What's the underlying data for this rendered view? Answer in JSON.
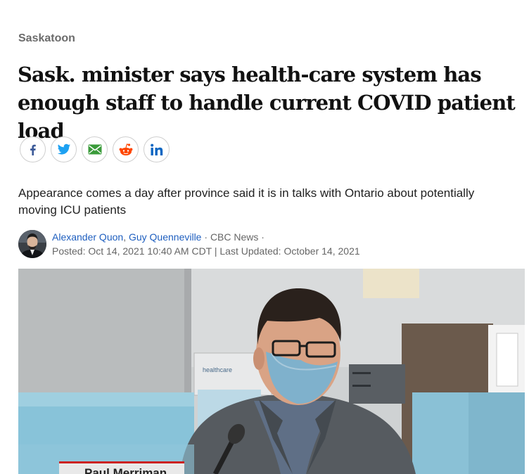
{
  "category": "Saskatoon",
  "headline": "Sask. minister says health-care system has enough staff to handle current COVID patient load",
  "share": {
    "buttons": [
      {
        "icon": "facebook-icon",
        "color": "#3b5998"
      },
      {
        "icon": "twitter-icon",
        "color": "#1da1f2"
      },
      {
        "icon": "email-icon",
        "color": "#3a9b3a"
      },
      {
        "icon": "reddit-icon",
        "color": "#ff4500"
      },
      {
        "icon": "linkedin-icon",
        "color": "#0a66c2"
      }
    ]
  },
  "deck": "Appearance comes a day after province said it is in talks with Ontario about potentially moving ICU patients",
  "byline": {
    "authors": [
      "Alexander Quon",
      "Guy Quenneville"
    ],
    "author_separator": ",",
    "outlet_separator": " · ",
    "source": "CBC News ·",
    "dateline": "Posted: Oct 14, 2021 10:40 AM CDT | Last Updated: October 14, 2021"
  },
  "hero": {
    "name_tag": "Paul Merriman"
  },
  "colors": {
    "link": "#1f5fbf",
    "category": "#6b6b6b",
    "accent_red": "#cc2222"
  }
}
